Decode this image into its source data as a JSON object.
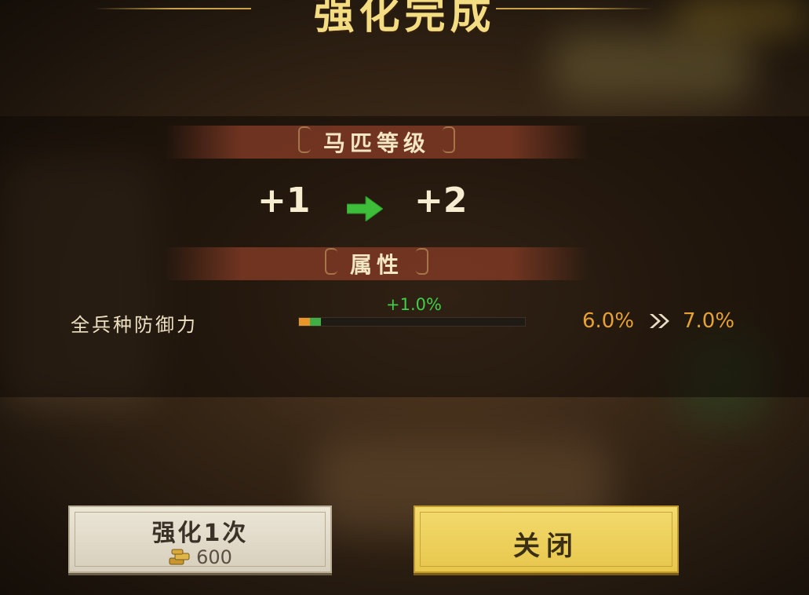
{
  "title": "强化完成",
  "level_section": {
    "label": "马匹等级",
    "from": "+1",
    "to": "+2",
    "arrow_color": "#3dbd3a"
  },
  "attribute_section": {
    "label": "属性",
    "stat": {
      "name": "全兵种防御力",
      "delta": "+1.0%",
      "old_value": "6.0%",
      "new_value": "7.0%",
      "progress_old": 0.06,
      "progress_new": 0.07
    }
  },
  "buttons": {
    "enhance_label": "强化1次",
    "enhance_cost": "600",
    "cost_icon": "gold-ingot-icon",
    "close_label": "关闭"
  },
  "colors": {
    "title": "#f4dc82",
    "value": "#e7a233",
    "delta": "#3fcf4a",
    "close_button": "#f0d35e"
  }
}
